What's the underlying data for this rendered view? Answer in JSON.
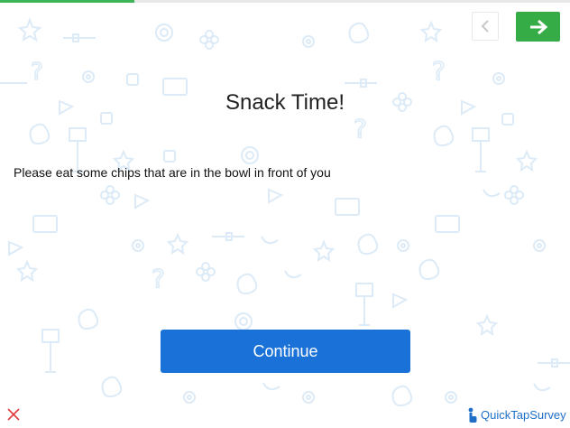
{
  "progress": {
    "fraction": 0.235,
    "color": "#3cb556"
  },
  "nav": {
    "back_icon": "chevron-left-icon",
    "next_icon": "arrow-right-icon",
    "next_color": "#35ac45"
  },
  "screen": {
    "title": "Snack Time!",
    "question": "Please eat some chips that are in the bowl in front of you"
  },
  "actions": {
    "continue_label": "Continue",
    "continue_color": "#1a72d8",
    "close_icon": "close-icon",
    "close_color": "#e23b3b"
  },
  "branding": {
    "name": "QuickTapSurvey",
    "icon": "tap-hand-icon"
  }
}
